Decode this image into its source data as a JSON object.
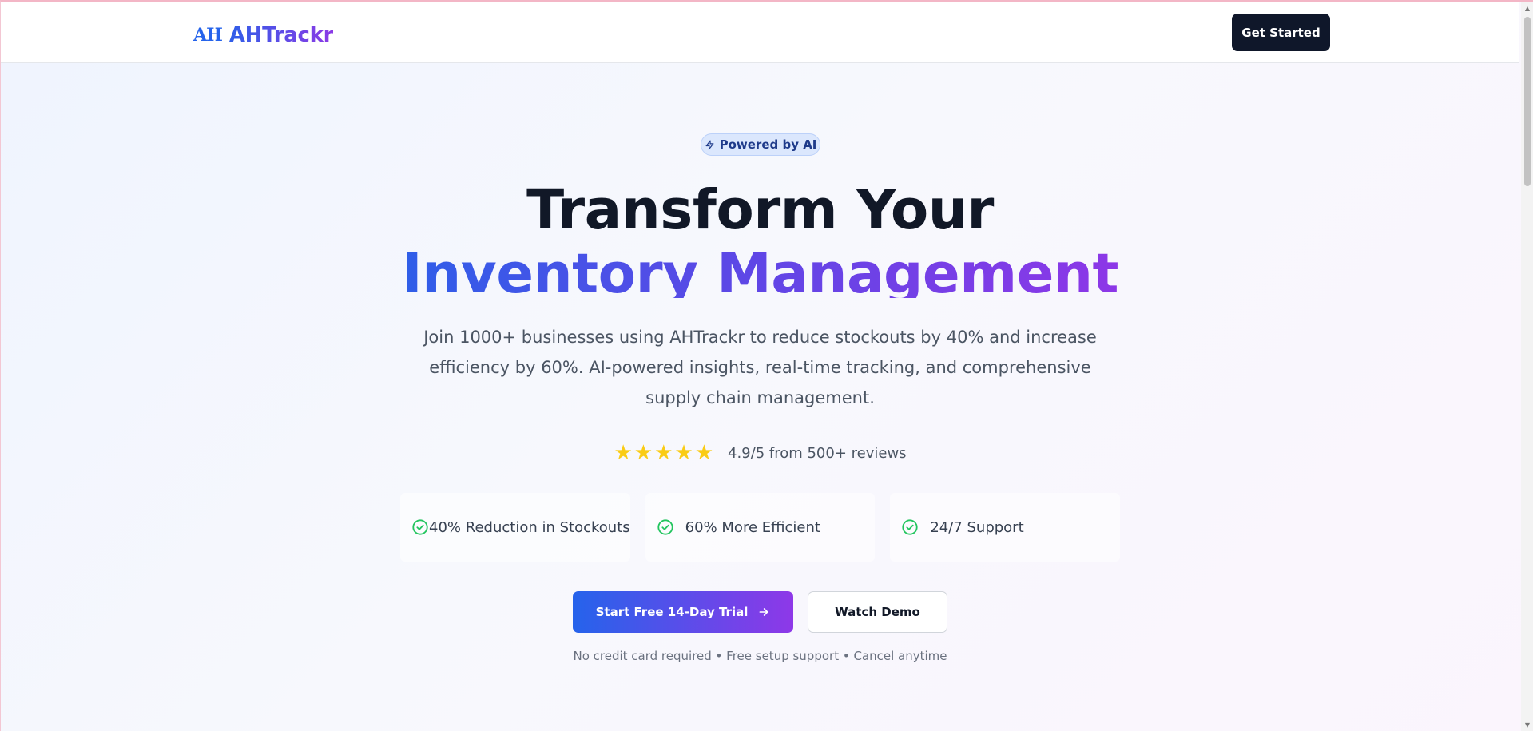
{
  "header": {
    "logo_mark": "AH",
    "brand_name": "AHTrackr",
    "get_started_label": "Get Started"
  },
  "hero": {
    "badge_label": "Powered by AI",
    "badge_icon": "lightning-icon",
    "title_line1": "Transform Your",
    "title_line2": "Inventory Management",
    "subtitle": "Join 1000+ businesses using AHTrackr to reduce stockouts by 40% and increase efficiency by 60%. AI-powered insights, real-time tracking, and comprehensive supply chain management.",
    "rating": {
      "stars": 5,
      "text": "4.9/5 from 500+ reviews"
    },
    "features": [
      {
        "label": "40% Reduction in Stockouts",
        "icon": "check-circle-icon"
      },
      {
        "label": "60% More Efficient",
        "icon": "check-circle-icon"
      },
      {
        "label": "24/7 Support",
        "icon": "check-circle-icon"
      }
    ],
    "primary_cta_label": "Start Free 14-Day Trial",
    "primary_cta_icon": "arrow-right-icon",
    "secondary_cta_label": "Watch Demo",
    "fineprint": "No credit card required • Free setup support • Cancel anytime"
  },
  "colors": {
    "brand_gradient_start": "#2563eb",
    "brand_gradient_end": "#9333ea",
    "dark_button": "#0f172a",
    "star": "#facc15",
    "check": "#22c55e"
  }
}
